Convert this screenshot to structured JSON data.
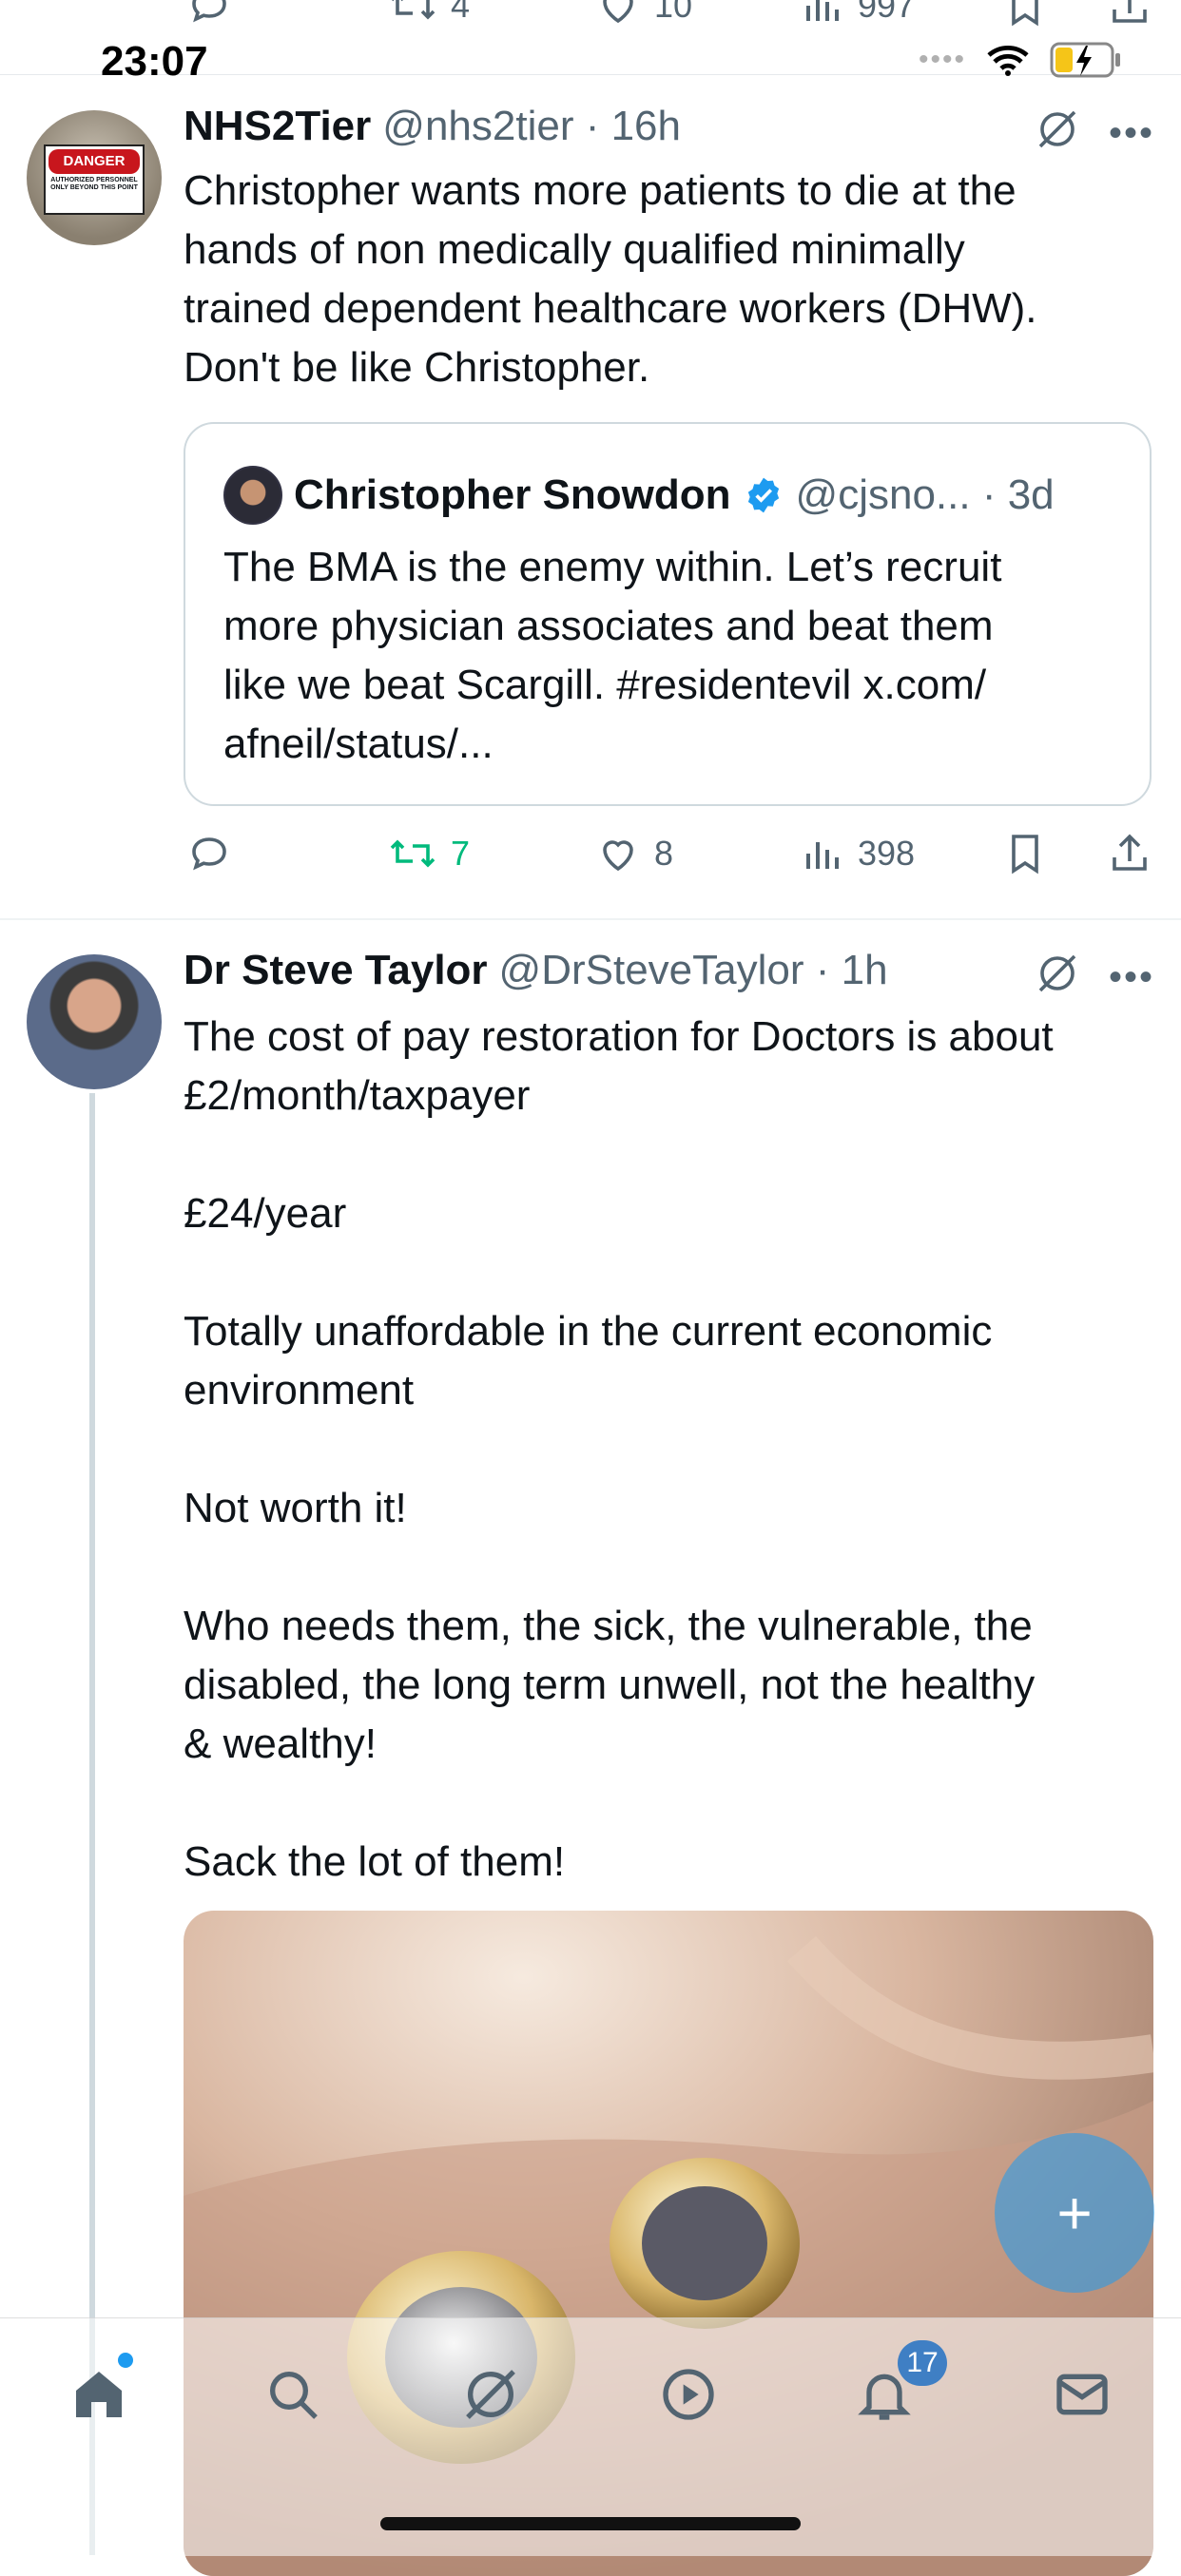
{
  "status_bar": {
    "time": "23:07"
  },
  "prev_tweet_actions": {
    "retweets": "4",
    "likes": "10",
    "views": "997"
  },
  "tweet1": {
    "display_name": "NHS2Tier",
    "handle_time": "@nhs2tier · 16h",
    "text_lines": [
      "Christopher wants more patients to die at the",
      "hands of non medically qualified minimally",
      "trained dependent healthcare workers (DHW).",
      "Don't be like Christopher."
    ],
    "avatar_sign": {
      "title": "DANGER",
      "subtitle": "AUTHORIZED PERSONNEL ONLY BEYOND THIS POINT"
    },
    "quote": {
      "display_name": "Christopher Snowdon",
      "handle_time": "@cjsno... · 3d",
      "text_lines": [
        "The BMA is the enemy within. Let’s recruit",
        "more physician associates and beat them",
        "like we beat Scargill. #residentevil x.com/",
        "afneil/status/..."
      ]
    },
    "actions": {
      "retweets": "7",
      "likes": "8",
      "views": "398"
    }
  },
  "tweet2": {
    "display_name": "Dr Steve Taylor",
    "handle_time": "@DrSteveTaylor · 1h",
    "paragraphs": [
      [
        "The cost of pay restoration for Doctors is about",
        "£2/month/taxpayer"
      ],
      [
        "£24/year"
      ],
      [
        "Totally unaffordable in the current economic",
        "environment"
      ],
      [
        "Not worth it!"
      ],
      [
        "Who needs them, the sick, the vulnerable, the",
        "disabled, the long term unwell, not the healthy",
        "& wealthy!"
      ],
      [
        "Sack the lot of them!"
      ]
    ]
  },
  "compose_button": {
    "label": "+"
  },
  "tab_bar": {
    "items": [
      {
        "name": "home-tab",
        "icon": "home-icon"
      },
      {
        "name": "search-tab",
        "icon": "search-icon"
      },
      {
        "name": "grok-tab",
        "icon": "grok-icon"
      },
      {
        "name": "video-tab",
        "icon": "play-icon"
      },
      {
        "name": "notifications-tab",
        "icon": "bell-icon"
      },
      {
        "name": "messages-tab",
        "icon": "envelope-icon"
      }
    ],
    "notifications_count": "17"
  },
  "colors": {
    "accent": "#1d9bf0",
    "retweet_active": "#00ba7c",
    "muted": "#536471",
    "border": "#cfd9de"
  }
}
